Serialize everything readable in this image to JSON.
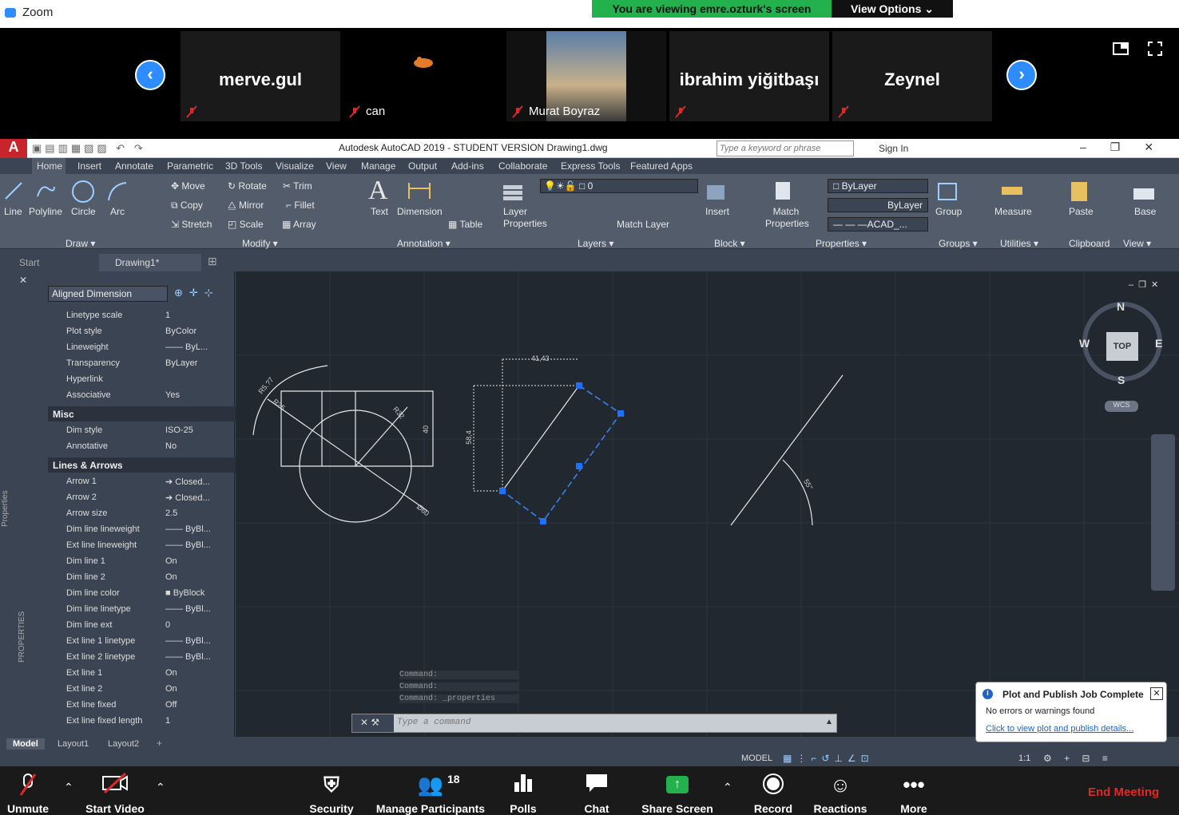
{
  "zoom": {
    "app_title": "Zoom",
    "viewing_banner": "You are viewing emre.ozturk's screen",
    "view_options": "View Options ⌄",
    "participants": [
      {
        "name": "merve.gul",
        "sub": ""
      },
      {
        "name": "",
        "sub": "can"
      },
      {
        "name": "",
        "sub": "Murat Boyraz"
      },
      {
        "name": "ibrahim yiğitbaşı",
        "sub": ""
      },
      {
        "name": "Zeynel",
        "sub": ""
      }
    ],
    "toolbar": {
      "unmute": "Unmute",
      "start_video": "Start Video",
      "security": "Security",
      "manage_participants": "Manage Participants",
      "participant_count": "18",
      "polls": "Polls",
      "chat": "Chat",
      "share_screen": "Share Screen",
      "record": "Record",
      "reactions": "Reactions",
      "more": "More",
      "end_meeting": "End Meeting"
    }
  },
  "acad": {
    "title": "Autodesk AutoCAD 2019 - STUDENT VERSION    Drawing1.dwg",
    "search_placeholder": "Type a keyword or phrase",
    "sign_in": "Sign In",
    "tabs": [
      "Home",
      "Insert",
      "Annotate",
      "Parametric",
      "3D Tools",
      "Visualize",
      "View",
      "Manage",
      "Output",
      "Add-ins",
      "Collaborate",
      "Express Tools",
      "Featured Apps"
    ],
    "ribbon": {
      "draw": [
        "Line",
        "Polyline",
        "Circle",
        "Arc"
      ],
      "modify": [
        "Move",
        "Rotate",
        "Trim",
        "Copy",
        "Mirror",
        "Fillet",
        "Stretch",
        "Scale",
        "Array"
      ],
      "annotation": [
        "Text",
        "Dimension",
        "Table"
      ],
      "layers": [
        "Layer Properties",
        "Match Layer",
        "0"
      ],
      "block": [
        "Insert"
      ],
      "properties": [
        "Match Properties",
        "ByLayer",
        "ByLayer",
        "— — —ACAD_..."
      ],
      "groups": [
        "Group"
      ],
      "utilities": [
        "Measure"
      ],
      "clipboard": [
        "Paste"
      ],
      "view": [
        "Base"
      ],
      "panels": [
        "Draw ▾",
        "Modify ▾",
        "Annotation ▾",
        "Layers ▾",
        "Block ▾",
        "Properties ▾",
        "Groups ▾",
        "Utilities ▾",
        "Clipboard",
        "View ▾"
      ]
    },
    "doc_tabs": [
      "Start",
      "Drawing1*"
    ],
    "props": {
      "selector": "Aligned Dimension",
      "rows_top": [
        [
          "Linetype scale",
          "1"
        ],
        [
          "Plot style",
          "ByColor"
        ],
        [
          "Lineweight",
          "—— ByL..."
        ],
        [
          "Transparency",
          "ByLayer"
        ],
        [
          "Hyperlink",
          ""
        ],
        [
          "Associative",
          "Yes"
        ]
      ],
      "sec_misc": "Misc",
      "rows_misc": [
        [
          "Dim style",
          "ISO-25"
        ],
        [
          "Annotative",
          "No"
        ]
      ],
      "sec_lines": "Lines & Arrows",
      "rows_lines": [
        [
          "Arrow 1",
          "➔ Closed..."
        ],
        [
          "Arrow 2",
          "➔ Closed..."
        ],
        [
          "Arrow size",
          "2.5"
        ],
        [
          "Dim line lineweight",
          "—— ByBl..."
        ],
        [
          "Ext line lineweight",
          "—— ByBl..."
        ],
        [
          "Dim line 1",
          "On"
        ],
        [
          "Dim line 2",
          "On"
        ],
        [
          "Dim line color",
          "■ ByBlock"
        ],
        [
          "Dim line linetype",
          "—— ByBl..."
        ],
        [
          "Dim line ext",
          "0"
        ],
        [
          "Ext line 1 linetype",
          "—— ByBl..."
        ],
        [
          "Ext line 2 linetype",
          "—— ByBl..."
        ],
        [
          "Ext line 1",
          "On"
        ],
        [
          "Ext line 2",
          "On"
        ],
        [
          "Ext line fixed",
          "Off"
        ],
        [
          "Ext line fixed length",
          "1"
        ]
      ],
      "side_label": "PROPERTIES",
      "side_label2": "Properties"
    },
    "command_history": [
      "Command:",
      "Command:",
      "Command: _properties"
    ],
    "command_placeholder": "Type a command",
    "layout_tabs": [
      "Model",
      "Layout1",
      "Layout2"
    ],
    "status_model": "MODEL",
    "status_scale": "1:1",
    "viewcube": {
      "n": "N",
      "s": "S",
      "e": "E",
      "w": "W",
      "top": "TOP",
      "wcs": "WCS"
    },
    "dims": {
      "d1": "R5.?7",
      "d2": "R25",
      "d3": "R32",
      "d4": "40",
      "d5": "Ø60",
      "d6": "41,43",
      "d7": "58,4",
      "d8": "55°"
    },
    "notification": {
      "title": "Plot and Publish Job Complete",
      "body": "No errors or warnings found",
      "link": "Click to view plot and publish details..."
    }
  }
}
